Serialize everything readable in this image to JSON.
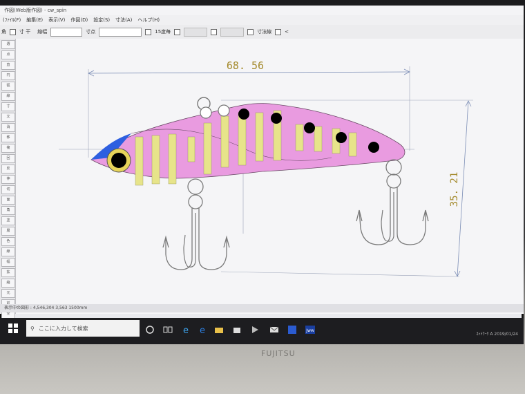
{
  "window": {
    "title": "作図(Web版作図)  -  cw_spin"
  },
  "menu": {
    "items": [
      "(ﾌｧｲﾙ(F)",
      "編集(E)",
      "表示(V)",
      "作図(D)",
      "設定(S)",
      "寸法(A)",
      "ヘルプ(H)"
    ]
  },
  "toolbar": {
    "items": [
      "角",
      "寸 干",
      "",
      "線幅",
      "寸点",
      "15度毎",
      "寸法線",
      "<"
    ]
  },
  "left_tools": {
    "labels": [
      "選",
      "点",
      "直",
      "円",
      "弧",
      "線",
      "寸",
      "文",
      "消",
      "移",
      "複",
      "回",
      "反",
      "伸",
      "切",
      "面",
      "角",
      "塗",
      "層",
      "色",
      "線",
      "幅",
      "拡",
      "縮",
      "元",
      "前",
      "全",
      "窓",
      "印",
      "保"
    ]
  },
  "drawing": {
    "width_dimension": "68. 56",
    "height_dimension": "35. 21",
    "colors": {
      "body": "#e99be0",
      "stripe": "#e7e48a",
      "eye": "#000000",
      "eye_ring": "#e6d35a",
      "head": "#2e5fe0",
      "dim": "#a48a2c",
      "hook": "#7a7a7a"
    }
  },
  "statusbar": {
    "text": "表示中の図形  :  4,546,304  3,563  1500mm"
  },
  "taskbar": {
    "search_placeholder": "ここに入力して検索",
    "tray_text": "ﾈｯﾄﾜｰｸ  A  2019/01/24"
  },
  "bezel": {
    "brand": "FUJITSU"
  }
}
